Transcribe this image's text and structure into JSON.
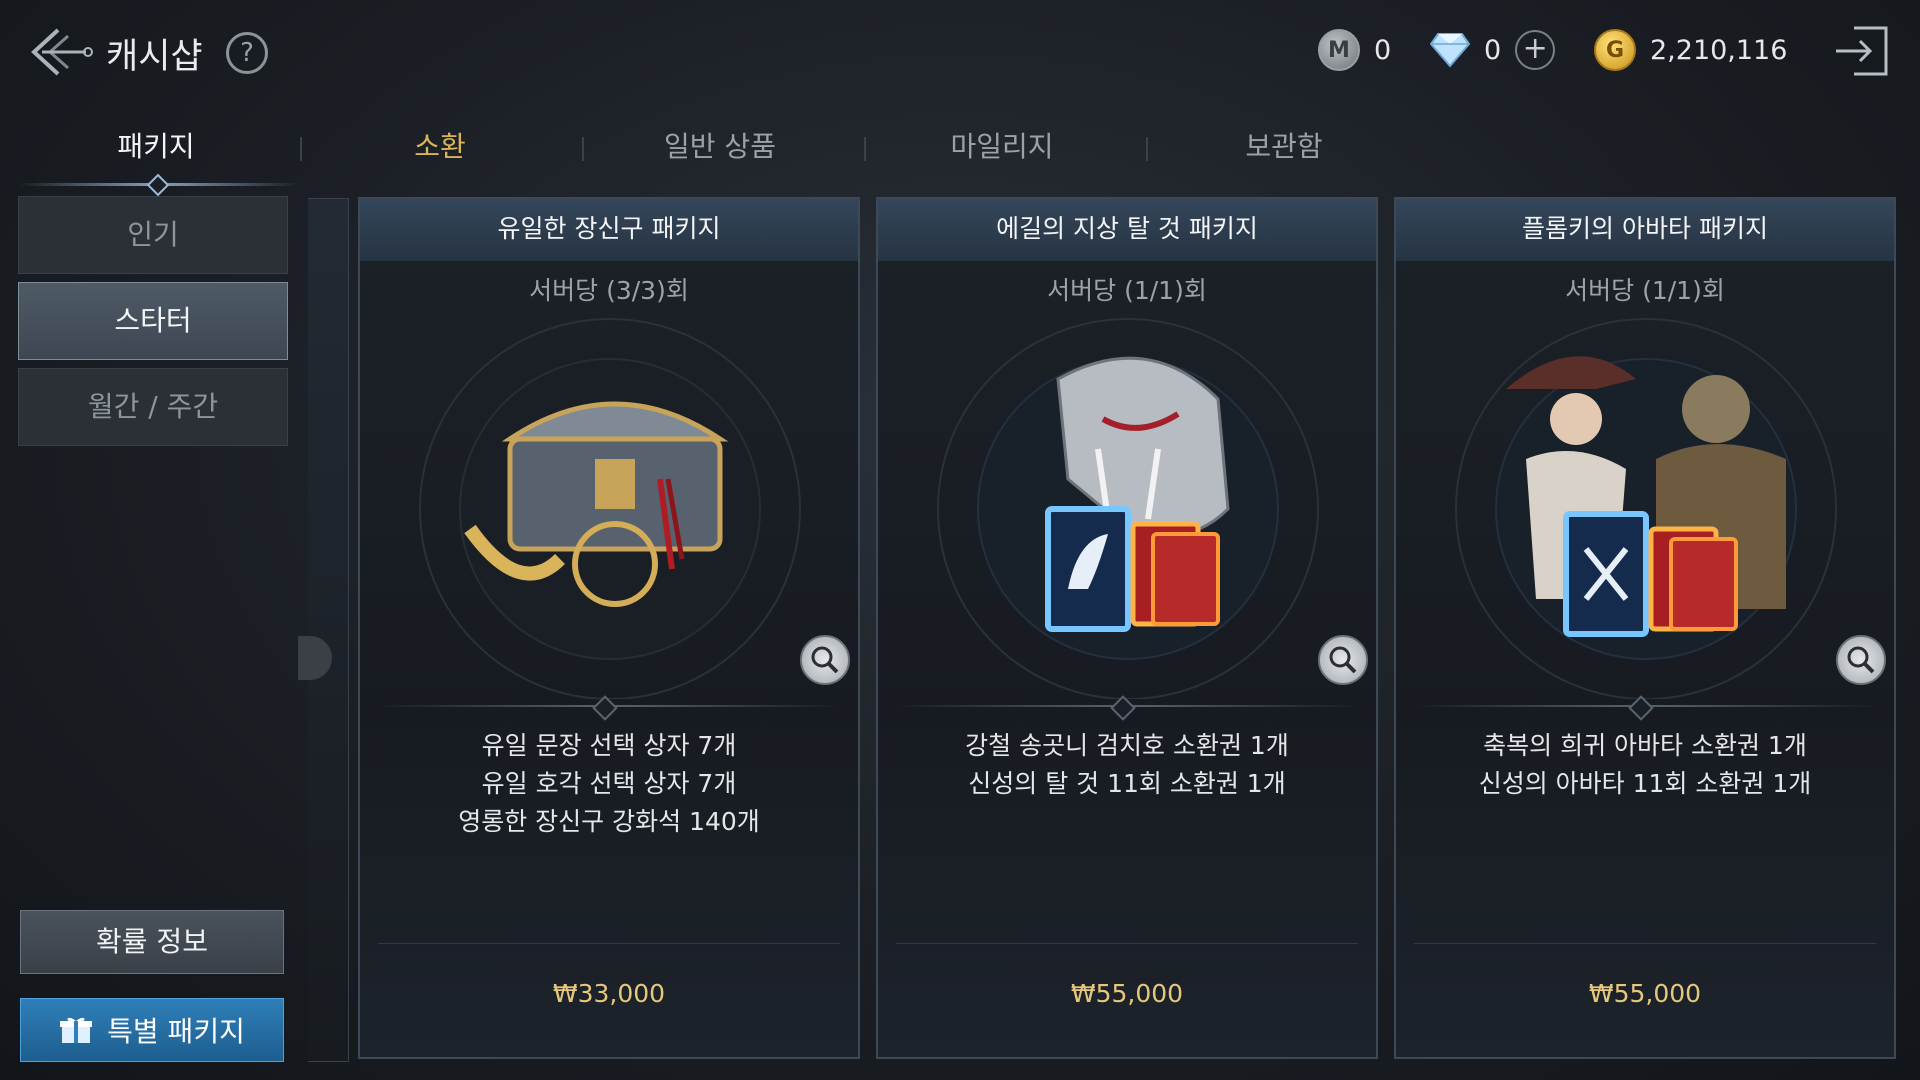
{
  "header": {
    "title": "캐시샵",
    "help_label": "?",
    "currencies": [
      {
        "name": "mileage",
        "icon": "m-coin-icon",
        "value": "0"
      },
      {
        "name": "diamond",
        "icon": "diamond-icon",
        "value": "0"
      },
      {
        "name": "gold",
        "icon": "gold-coin-icon",
        "value": "2,210,116"
      }
    ],
    "plus_label": "+"
  },
  "tabs": [
    {
      "label": "패키지",
      "state": "active"
    },
    {
      "label": "소환",
      "state": "highlight"
    },
    {
      "label": "일반 상품",
      "state": "normal"
    },
    {
      "label": "마일리지",
      "state": "normal"
    },
    {
      "label": "보관함",
      "state": "normal"
    }
  ],
  "sidebar": {
    "items": [
      {
        "label": "인기"
      },
      {
        "label": "스타터"
      },
      {
        "label": "월간 / 주간"
      }
    ],
    "probability_label": "확률 정보",
    "special_package_label": "특별 패키지"
  },
  "cards": [
    {
      "title": "유일한 장신구 패키지",
      "limit": "서버당 (3/3)회",
      "art_icon": "treasure-chest-icon",
      "items": [
        "유일 문장 선택 상자 7개",
        "유일 호각 선택 상자 7개",
        "영롱한 장신구 강화석 140개"
      ],
      "price": "₩33,000"
    },
    {
      "title": "에길의 지상 탈 것 패키지",
      "limit": "서버당 (1/1)회",
      "art_icon": "mount-summon-icon",
      "items": [
        "강철 송곳니 검치호 소환권 1개",
        "신성의 탈 것 11회 소환권 1개"
      ],
      "price": "₩55,000"
    },
    {
      "title": "플롬키의 아바타 패키지",
      "limit": "서버당 (1/1)회",
      "art_icon": "avatar-summon-icon",
      "items": [
        "축복의 희귀 아바타 소환권 1개",
        "신성의 아바타 11회 소환권 1개"
      ],
      "price": "₩55,000"
    }
  ],
  "colors": {
    "accent_gold": "#d9b45a",
    "price_gold": "#e7c77a",
    "special_blue": "#2f7fb8"
  }
}
